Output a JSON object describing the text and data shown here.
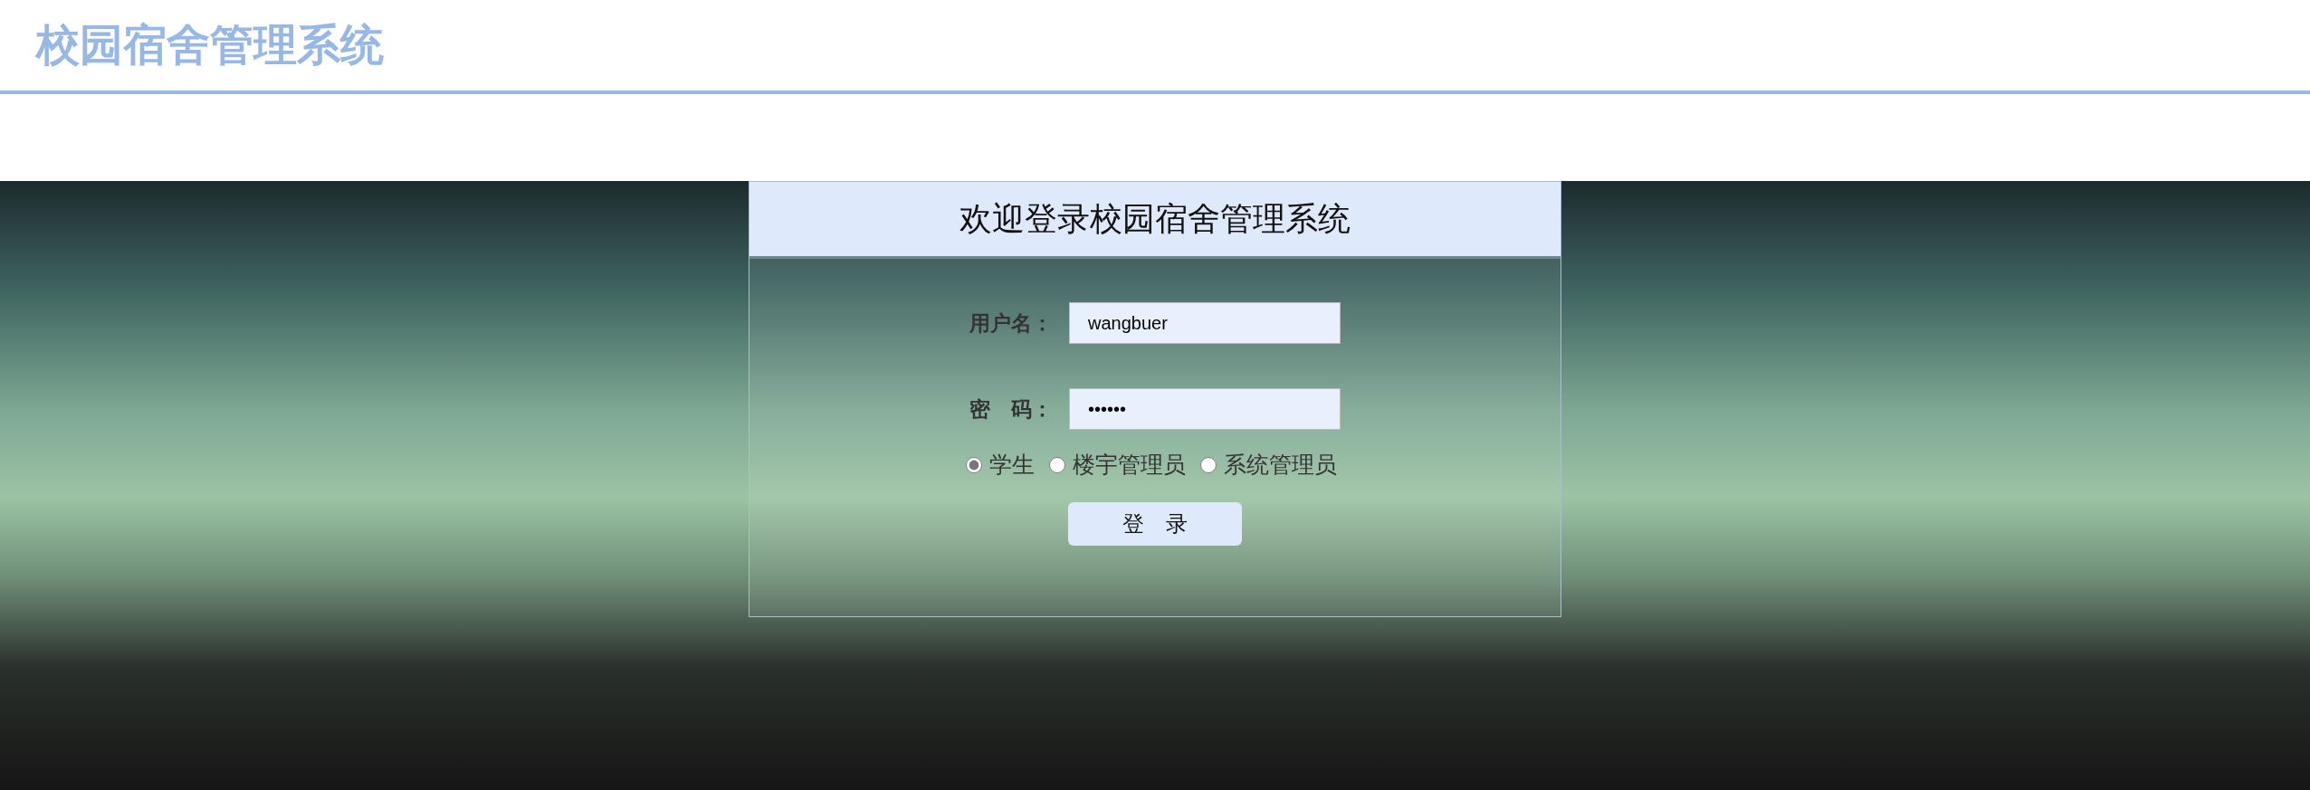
{
  "header": {
    "title": "校园宿舍管理系统"
  },
  "login": {
    "title": "欢迎登录校园宿舍管理系统",
    "username": {
      "label": "用户名：",
      "value": "wangbuer"
    },
    "password": {
      "label": "密　码：",
      "value": "••••••"
    },
    "roles": [
      {
        "label": "学生",
        "selected": true
      },
      {
        "label": "楼宇管理员",
        "selected": false
      },
      {
        "label": "系统管理员",
        "selected": false
      }
    ],
    "submit": "登　录"
  }
}
